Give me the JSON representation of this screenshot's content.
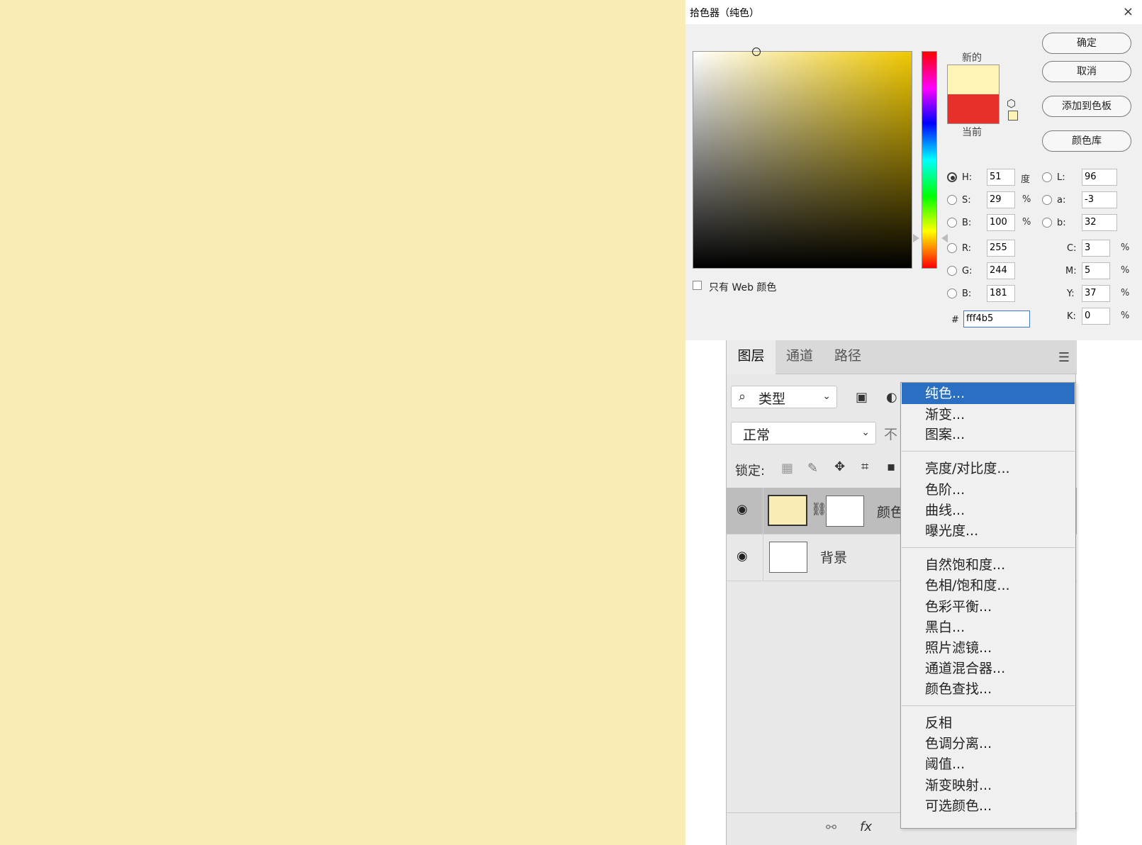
{
  "canvas": {
    "color": "#f9ecb5"
  },
  "picker": {
    "title": "拾色器（纯色）",
    "close": "×",
    "new_label": "新的",
    "current_label": "当前",
    "new_color": "#fff4b5",
    "current_color": "#e8302b",
    "hue_field_color": "#f0c800",
    "buttons": {
      "ok": "确定",
      "cancel": "取消",
      "add_swatch": "添加到色板",
      "libraries": "颜色库"
    },
    "hsb": {
      "h_label": "H:",
      "h": "51",
      "h_unit": "度",
      "s_label": "S:",
      "s": "29",
      "s_unit": "%",
      "b_label": "B:",
      "b": "100",
      "b_unit": "%"
    },
    "lab": {
      "l_label": "L:",
      "l": "96",
      "a_label": "a:",
      "a": "-3",
      "b_label": "b:",
      "b": "32"
    },
    "rgb": {
      "r_label": "R:",
      "r": "255",
      "g_label": "G:",
      "g": "244",
      "b_label": "B:",
      "b": "181"
    },
    "cmyk": {
      "c_label": "C:",
      "c": "3",
      "m_label": "M:",
      "m": "5",
      "y_label": "Y:",
      "y": "37",
      "k_label": "K:",
      "k": "0",
      "unit": "%"
    },
    "hex_label": "#",
    "hex": "fff4b5",
    "web_only": "只有 Web 颜色"
  },
  "layers": {
    "tabs": [
      "图层",
      "通道",
      "路径"
    ],
    "filter": "类型",
    "blend": "正常",
    "opacity_label_fragment": "不",
    "lock_label": "锁定:",
    "rows": [
      {
        "name": "颜色",
        "thumb_color": "#f9ecb5"
      },
      {
        "name": "背景",
        "thumb_color": "#ffffff"
      }
    ],
    "footer_fx": "fx"
  },
  "menu": {
    "group1": [
      "纯色...",
      "渐变...",
      "图案..."
    ],
    "group2": [
      "亮度/对比度...",
      "色阶...",
      "曲线...",
      "曝光度..."
    ],
    "group3": [
      "自然饱和度...",
      "色相/饱和度...",
      "色彩平衡...",
      "黑白...",
      "照片滤镜...",
      "通道混合器...",
      "颜色查找..."
    ],
    "group4": [
      "反相",
      "色调分离...",
      "阈值...",
      "渐变映射...",
      "可选颜色..."
    ]
  }
}
